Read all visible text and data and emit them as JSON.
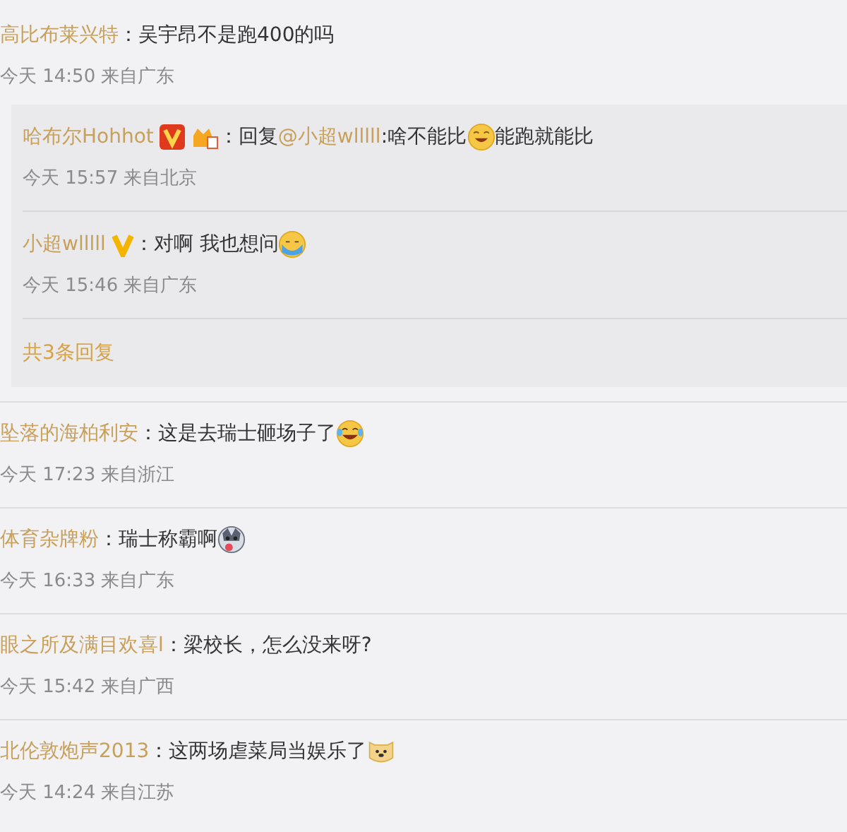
{
  "comments": [
    {
      "name": "高比布莱兴特",
      "parts": [
        {
          "kind": "text",
          "text": "：吴宇昂不是跑400的吗"
        }
      ],
      "meta": "今天 14:50 来自广东",
      "replies": [
        {
          "name": "哈布尔Hohhot",
          "badges": [
            {
              "kind": "red-v"
            },
            {
              "kind": "crown"
            }
          ],
          "parts": [
            {
              "kind": "text",
              "text": "：回复"
            },
            {
              "kind": "mention",
              "text": "@小超wlllll"
            },
            {
              "kind": "text",
              "text": ":啥不能比"
            },
            {
              "kind": "grin"
            },
            {
              "kind": "text",
              "text": "能跑就能比"
            }
          ],
          "meta": "今天 15:57 来自北京"
        },
        {
          "name": "小超wlllll",
          "badges": [
            {
              "kind": "gold-v"
            }
          ],
          "parts": [
            {
              "kind": "text",
              "text": "：对啊 我也想问"
            },
            {
              "kind": "tears"
            }
          ],
          "meta": "今天 15:46 来自广东"
        }
      ],
      "more_replies": "共3条回复"
    },
    {
      "name": "坠落的海柏利安",
      "parts": [
        {
          "kind": "text",
          "text": "：这是去瑞士砸场子了"
        },
        {
          "kind": "laughcry"
        }
      ],
      "meta": "今天 17:23 来自浙江"
    },
    {
      "name": "体育杂牌粉",
      "parts": [
        {
          "kind": "text",
          "text": "：瑞士称霸啊"
        },
        {
          "kind": "husky"
        }
      ],
      "meta": "今天 16:33 来自广东"
    },
    {
      "name": "眼之所及满目欢喜l",
      "parts": [
        {
          "kind": "text",
          "text": "：梁校长，怎么没来呀?"
        }
      ],
      "meta": "今天 15:42 来自广西"
    },
    {
      "name": "北伦敦炮声2013",
      "parts": [
        {
          "kind": "text",
          "text": "：这两场虐菜局当娱乐了"
        },
        {
          "kind": "doge"
        }
      ],
      "meta": "今天 14:24 来自江苏"
    }
  ]
}
